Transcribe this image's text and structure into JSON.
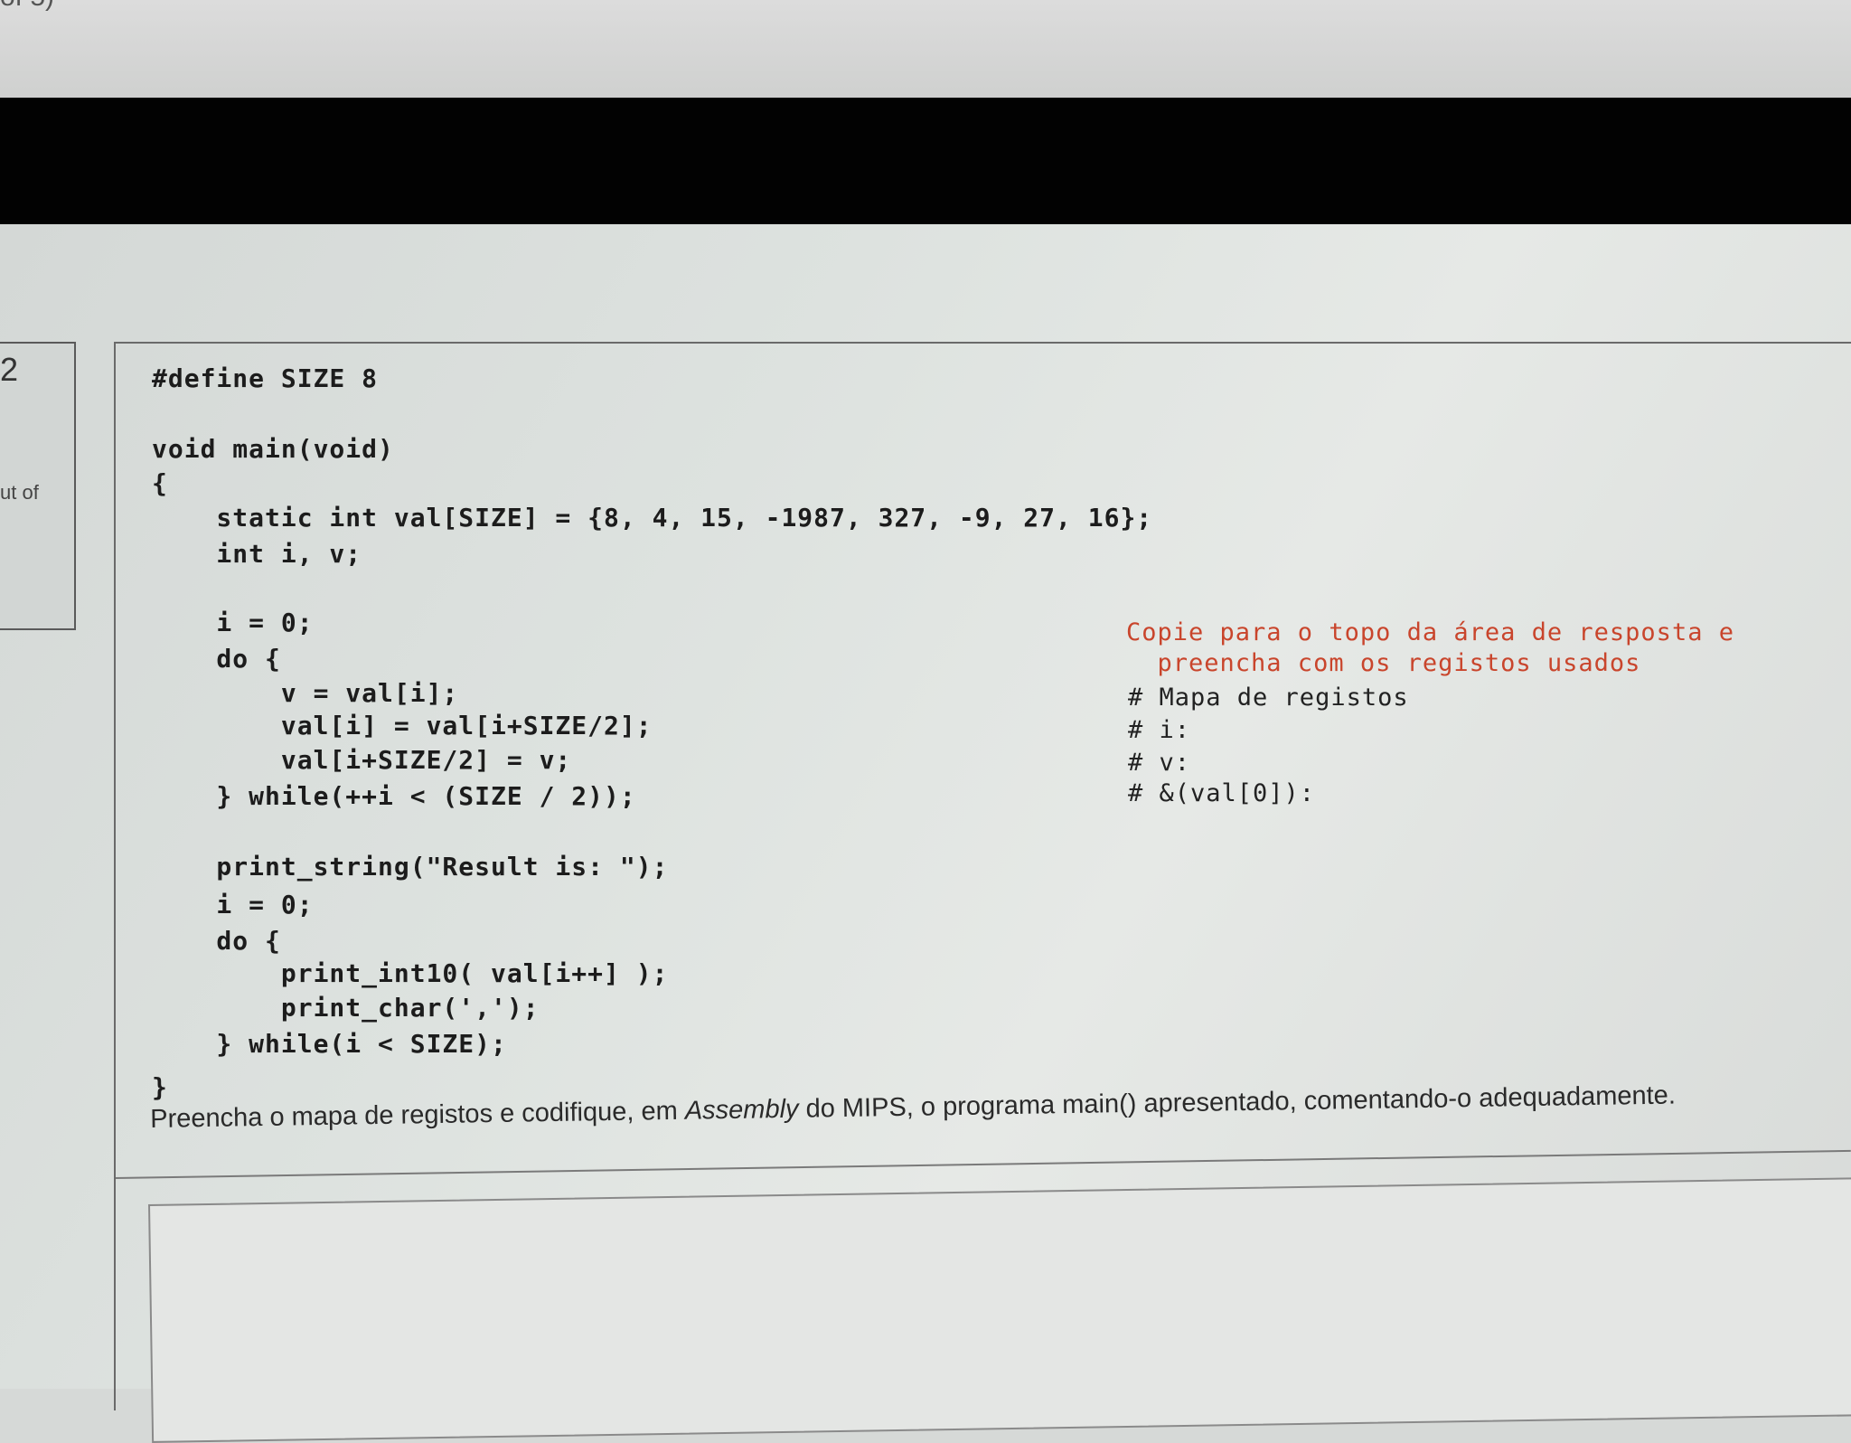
{
  "header": {
    "fragment": "of 5)"
  },
  "question": {
    "number": "2",
    "out_of_fragment": "ut of"
  },
  "code": {
    "lines": [
      "#define SIZE 8",
      "void main(void)",
      "{",
      "    static int val[SIZE] = {8, 4, 15, -1987, 327, -9, 27, 16};",
      "    int i, v;",
      "    i = 0;",
      "    do {",
      "        v = val[i];",
      "        val[i] = val[i+SIZE/2];",
      "        val[i+SIZE/2] = v;",
      "    } while(++i < (SIZE / 2));",
      "    print_string(\"Result is: \");",
      "    i = 0;",
      "    do {",
      "        print_int10( val[i++] );",
      "        print_char(',');",
      "    } while(i < SIZE);",
      "}"
    ]
  },
  "side_note": {
    "red_line_1": "Copie para o topo da área de resposta e",
    "red_line_2": "  preencha com os registos usados",
    "map_title": "# Mapa de registos",
    "reg_i": "# i:",
    "reg_v": "# v:",
    "reg_val": "# &(val[0]):"
  },
  "instruction": {
    "part1": "Preencha o mapa de registos e codifique, em ",
    "italic": "Assembly",
    "part2": " do MIPS, o  programa main() apresentado, comentando-o adequadamente."
  },
  "colors": {
    "note_red": "#c9452c",
    "black_bar": "#020202"
  }
}
